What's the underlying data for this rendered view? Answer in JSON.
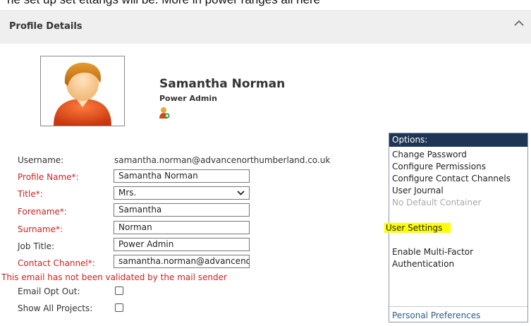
{
  "top_cutoff_text": "ne set up set ettangs will be. More in power ranges all here",
  "section": {
    "title": "Profile Details"
  },
  "user": {
    "name": "Samantha Norman",
    "role": "Power Admin"
  },
  "form": {
    "username_label": "Username:",
    "username_value": "samantha.norman@advancenorthumberland.co.uk",
    "profile_name_label": "Profile Name*:",
    "profile_name_value": "Samantha Norman",
    "title_label": "Title*:",
    "title_value": "Mrs.",
    "forename_label": "Forename*:",
    "forename_value": "Samantha",
    "surname_label": "Surname*:",
    "surname_value": "Norman",
    "job_title_label": "Job Title:",
    "job_title_value": "Power Admin",
    "contact_channel_label": "Contact Channel*:",
    "contact_channel_value": "samantha.norman@advancenorthumberland.co.uk",
    "email_warning": "This email has not been validated by the mail sender",
    "email_opt_out_label": "Email Opt Out:",
    "show_all_projects_label": "Show All Projects:"
  },
  "options": {
    "header": "Options:",
    "change_password": "Change Password",
    "configure_permissions": "Configure Permissions",
    "configure_contact_channels": "Configure Contact Channels",
    "user_journal": "User Journal",
    "no_default_container": "No Default Container",
    "user_settings": "User Settings",
    "enable_mfa_line1": "Enable Multi-Factor",
    "enable_mfa_line2": "Authentication",
    "personal_preferences": "Personal Preferences"
  },
  "colors": {
    "required_label": "#cc2222",
    "options_header_bg": "#1e3553",
    "highlight": "#ffff00",
    "link": "#2f5d8a"
  }
}
